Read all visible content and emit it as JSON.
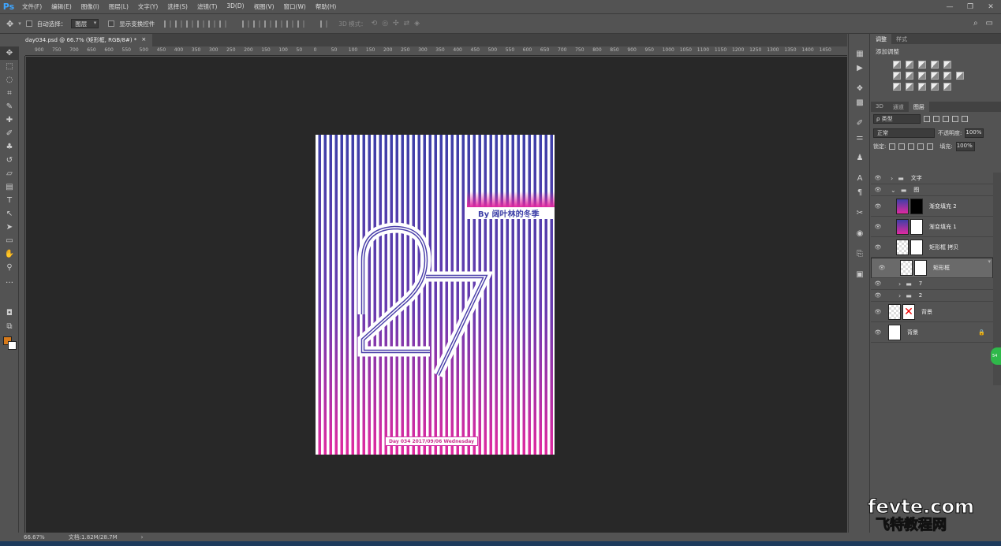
{
  "app": {
    "logo": "Ps"
  },
  "menu": [
    "文件(F)",
    "编辑(E)",
    "图像(I)",
    "图层(L)",
    "文字(Y)",
    "选择(S)",
    "滤镜(T)",
    "3D(D)",
    "视图(V)",
    "窗口(W)",
    "帮助(H)"
  ],
  "window_controls": [
    "—",
    "❐",
    "✕"
  ],
  "options": {
    "auto_select_label": "自动选择：",
    "auto_select_value": "图层",
    "show_transform_label": "显示变换控件",
    "mode3d_label": "3D 模式："
  },
  "document": {
    "tab_title": "day034.psd @ 66.7% (矩形框, RGB/8#) *",
    "tab_close": "×",
    "zoom": "66.67%",
    "doc_size": "文档:1.82M/28.7M",
    "status_arrow": "›"
  },
  "ruler_labels": [
    "900",
    "750",
    "700",
    "650",
    "600",
    "550",
    "500",
    "450",
    "400",
    "350",
    "300",
    "250",
    "200",
    "150",
    "100",
    "50",
    "0",
    "50",
    "100",
    "150",
    "200",
    "250",
    "300",
    "350",
    "400",
    "450",
    "500",
    "550",
    "600",
    "650",
    "700",
    "750",
    "800",
    "850",
    "900",
    "950",
    "1000",
    "1050",
    "1100",
    "1150",
    "1200",
    "1250",
    "1300",
    "1350",
    "1400",
    "1450"
  ],
  "poster": {
    "byline": "By 阔叶林的冬季",
    "date_line": "Day 034  2017/09/06  Wednesday",
    "colors": {
      "top": "#3d3fa8",
      "bottom": "#e02aa0",
      "stripe": "#ffffff"
    }
  },
  "panel": {
    "adjust_tabs": [
      "调整",
      "样式"
    ],
    "adjust_title": "添加调整",
    "layer_tabs": [
      "3D",
      "通道",
      "图层"
    ],
    "filter_kind": "ρ 类型",
    "blend_mode": "正常",
    "opacity_label": "不透明度:",
    "opacity_value": "100%",
    "lock_label": "锁定:",
    "fill_label": "填充:",
    "fill_value": "100%"
  },
  "layers": [
    {
      "name": "文字",
      "kind": "group",
      "indent": 0,
      "expanded": false
    },
    {
      "name": "图",
      "kind": "group",
      "indent": 0,
      "expanded": true
    },
    {
      "name": "渐变填充 2",
      "kind": "fill",
      "indent": 1,
      "thumb": "grad",
      "mask": "black"
    },
    {
      "name": "渐变填充 1",
      "kind": "fill",
      "indent": 1,
      "thumb": "grad",
      "mask": "white"
    },
    {
      "name": "矩形框 拷贝",
      "kind": "smart",
      "indent": 1,
      "thumb": "check",
      "mask": "white"
    },
    {
      "name": "矩形框",
      "kind": "smart",
      "indent": 1,
      "thumb": "check",
      "mask": "white",
      "selected": true
    },
    {
      "name": "7",
      "kind": "group",
      "indent": 1,
      "expanded": false
    },
    {
      "name": "2",
      "kind": "group",
      "indent": 1,
      "expanded": false
    },
    {
      "name": "背景",
      "kind": "smart",
      "indent": 0,
      "thumb": "stripes",
      "mask": "x"
    },
    {
      "name": "背景",
      "kind": "background",
      "indent": 0,
      "thumb": "white",
      "locked": true
    }
  ],
  "watermark": {
    "line1": "fevte.com",
    "line2": "飞特教程网"
  },
  "badge": "54"
}
